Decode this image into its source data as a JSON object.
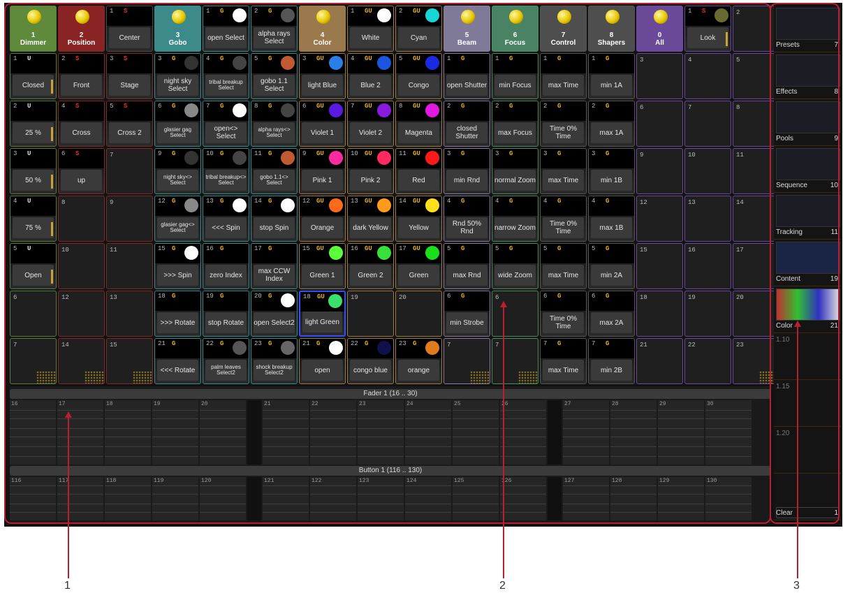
{
  "headers": [
    {
      "num": "1",
      "label": "Dimmer",
      "color": "#5f8a3c"
    },
    {
      "num": "2",
      "label": "Position",
      "color": "#8a2424"
    },
    {
      "num": "",
      "label": "",
      "color": ""
    },
    {
      "num": "3",
      "label": "Gobo",
      "color": "#3c8a8a"
    },
    {
      "num": "",
      "label": "",
      "color": ""
    },
    {
      "num": "",
      "label": "",
      "color": ""
    },
    {
      "num": "4",
      "label": "Color",
      "color": "#9a7a4c"
    },
    {
      "num": "",
      "label": "",
      "color": ""
    },
    {
      "num": "",
      "label": "",
      "color": ""
    },
    {
      "num": "5",
      "label": "Beam",
      "color": "#7f7a98"
    },
    {
      "num": "6",
      "label": "Focus",
      "color": "#4a8264"
    },
    {
      "num": "7",
      "label": "Control",
      "color": "#4e4e4e"
    },
    {
      "num": "8",
      "label": "Shapers",
      "color": "#4e4e4e"
    },
    {
      "num": "0",
      "label": "All",
      "color": "#6a4a98"
    }
  ],
  "grid": [
    [
      {
        "type": "header",
        "h": 0,
        "group": "Dimmer"
      },
      {
        "type": "header",
        "h": 1,
        "group": "Position"
      },
      {
        "num": "1",
        "tag": "S",
        "tagColor": "#e03030",
        "label": "Center",
        "group": "Center"
      },
      {
        "type": "header",
        "h": 3,
        "group": "Gobo"
      },
      {
        "num": "1",
        "tag": "G",
        "tagColor": "#e0b020",
        "swatch": "#ffffff",
        "label": "open Select",
        "group": "Gobo"
      },
      {
        "num": "2",
        "tag": "G",
        "tagColor": "#e0b020",
        "swatch": "#555555",
        "label": "alpha rays Select",
        "group": "Gobo"
      },
      {
        "type": "header",
        "h": 6,
        "group": "Color"
      },
      {
        "num": "1",
        "tag": "GU",
        "tagColor": "#e0b020",
        "swatch": "#ffffff",
        "label": "White",
        "group": "Color"
      },
      {
        "num": "2",
        "tag": "GU",
        "tagColor": "#e0b020",
        "swatch": "#19d6d6",
        "label": "Cyan",
        "group": "Color"
      },
      {
        "type": "header",
        "h": 9,
        "group": "Beam"
      },
      {
        "type": "header",
        "h": 10,
        "group": "Focus"
      },
      {
        "type": "header",
        "h": 11,
        "group": "Control"
      },
      {
        "type": "header",
        "h": 12,
        "group": "Shapers"
      },
      {
        "type": "header",
        "h": 13,
        "group": "All"
      },
      {
        "num": "1",
        "tag": "S",
        "tagColor": "#e03030",
        "swatch": "#6a6a30",
        "label": "Look",
        "group": "Look",
        "bar": true
      },
      {
        "type": "empty",
        "num": "2",
        "group": "Look"
      }
    ],
    [
      {
        "num": "1",
        "tag": "U",
        "tagColor": "#dddddd",
        "label": "Closed",
        "group": "Dimmer",
        "bar": true
      },
      {
        "num": "2",
        "tag": "S",
        "tagColor": "#e03030",
        "label": "Front",
        "group": "Position"
      },
      {
        "num": "3",
        "tag": "S",
        "tagColor": "#e03030",
        "label": "Stage",
        "group": "Position"
      },
      {
        "num": "3",
        "tag": "G",
        "tagColor": "#e0b020",
        "swatch": "#333333",
        "label": "night sky Select",
        "group": "Gobo"
      },
      {
        "num": "4",
        "tag": "G",
        "tagColor": "#e0b020",
        "swatch": "#444444",
        "label": "tribal breakup Select",
        "group": "Gobo",
        "small": true
      },
      {
        "num": "5",
        "tag": "G",
        "tagColor": "#e0b020",
        "swatch": "#c05a30",
        "label": "gobo 1.1 Select",
        "group": "Gobo"
      },
      {
        "num": "3",
        "tag": "GU",
        "tagColor": "#e0b020",
        "swatch": "#2a7ee8",
        "label": "light Blue",
        "group": "Color"
      },
      {
        "num": "4",
        "tag": "GU",
        "tagColor": "#e0b020",
        "swatch": "#1a56e0",
        "label": "Blue 2",
        "group": "Color"
      },
      {
        "num": "5",
        "tag": "GU",
        "tagColor": "#e0b020",
        "swatch": "#1a2ae0",
        "label": "Congo",
        "group": "Color"
      },
      {
        "num": "1",
        "tag": "G",
        "tagColor": "#e0b020",
        "label": "open Shutter",
        "group": "Beam"
      },
      {
        "num": "1",
        "tag": "G",
        "tagColor": "#e0b020",
        "label": "min Focus",
        "group": "Focus"
      },
      {
        "num": "1",
        "tag": "G",
        "tagColor": "#e0b020",
        "label": "max Time",
        "group": "Control"
      },
      {
        "num": "1",
        "tag": "G",
        "tagColor": "#e0b020",
        "label": "min 1A",
        "group": "Shapers"
      },
      {
        "type": "empty",
        "num": "3",
        "group": "All"
      },
      {
        "type": "empty",
        "num": "4",
        "group": "Look"
      },
      {
        "type": "empty",
        "num": "5",
        "group": "Look"
      }
    ],
    [
      {
        "num": "2",
        "tag": "U",
        "tagColor": "#dddddd",
        "label": "25 %",
        "group": "Dimmer",
        "bar": true
      },
      {
        "num": "4",
        "tag": "S",
        "tagColor": "#e03030",
        "label": "Cross",
        "group": "Position"
      },
      {
        "num": "5",
        "tag": "S",
        "tagColor": "#e03030",
        "label": "Cross 2",
        "group": "Position"
      },
      {
        "num": "6",
        "tag": "G",
        "tagColor": "#e0b020",
        "swatch": "#888888",
        "label": "glasier gag Select",
        "group": "Gobo",
        "small": true
      },
      {
        "num": "7",
        "tag": "G",
        "tagColor": "#e0b020",
        "swatch": "#ffffff",
        "label": "open<> Select",
        "group": "Gobo"
      },
      {
        "num": "8",
        "tag": "G",
        "tagColor": "#e0b020",
        "swatch": "#444444",
        "label": "alpha rays<> Select",
        "group": "Gobo",
        "small": true
      },
      {
        "num": "6",
        "tag": "GU",
        "tagColor": "#e0b020",
        "swatch": "#5a1ae0",
        "label": "Violet 1",
        "group": "Color"
      },
      {
        "num": "7",
        "tag": "GU",
        "tagColor": "#e0b020",
        "swatch": "#8a1ae0",
        "label": "Violet 2",
        "group": "Color"
      },
      {
        "num": "8",
        "tag": "GU",
        "tagColor": "#e0b020",
        "swatch": "#e01ae0",
        "label": "Magenta",
        "group": "Color"
      },
      {
        "num": "2",
        "tag": "G",
        "tagColor": "#e0b020",
        "label": "closed Shutter",
        "group": "Beam"
      },
      {
        "num": "2",
        "tag": "G",
        "tagColor": "#e0b020",
        "label": "max Focus",
        "group": "Focus"
      },
      {
        "num": "2",
        "tag": "G",
        "tagColor": "#e0b020",
        "label": "Time 0% Time",
        "group": "Control"
      },
      {
        "num": "2",
        "tag": "G",
        "tagColor": "#e0b020",
        "label": "max 1A",
        "group": "Shapers"
      },
      {
        "type": "empty",
        "num": "6",
        "group": "All"
      },
      {
        "type": "empty",
        "num": "7",
        "group": "Look"
      },
      {
        "type": "empty",
        "num": "8",
        "group": "Look"
      }
    ],
    [
      {
        "num": "3",
        "tag": "U",
        "tagColor": "#dddddd",
        "label": "50 %",
        "group": "Dimmer",
        "bar": true
      },
      {
        "num": "6",
        "tag": "S",
        "tagColor": "#e03030",
        "label": "up",
        "group": "Position"
      },
      {
        "type": "empty",
        "num": "7",
        "group": "Position"
      },
      {
        "num": "9",
        "tag": "G",
        "tagColor": "#e0b020",
        "swatch": "#333333",
        "label": "night sky<> Select",
        "group": "Gobo",
        "small": true
      },
      {
        "num": "10",
        "tag": "G",
        "tagColor": "#e0b020",
        "swatch": "#444444",
        "label": "tribal breakup<> Select",
        "group": "Gobo",
        "small": true
      },
      {
        "num": "11",
        "tag": "G",
        "tagColor": "#e0b020",
        "swatch": "#c05a30",
        "label": "gobo 1.1<> Select",
        "group": "Gobo",
        "small": true
      },
      {
        "num": "9",
        "tag": "GU",
        "tagColor": "#e0b020",
        "swatch": "#ff2aa0",
        "label": "Pink 1",
        "group": "Color"
      },
      {
        "num": "10",
        "tag": "GU",
        "tagColor": "#e0b020",
        "swatch": "#ff2a60",
        "label": "Pink 2",
        "group": "Color"
      },
      {
        "num": "11",
        "tag": "GU",
        "tagColor": "#e0b020",
        "swatch": "#ff1a1a",
        "label": "Red",
        "group": "Color"
      },
      {
        "num": "3",
        "tag": "G",
        "tagColor": "#e0b020",
        "label": "min Rnd",
        "group": "Beam"
      },
      {
        "num": "3",
        "tag": "G",
        "tagColor": "#e0b020",
        "label": "normal Zoom",
        "group": "Focus"
      },
      {
        "num": "3",
        "tag": "G",
        "tagColor": "#e0b020",
        "label": "max Time",
        "group": "Control"
      },
      {
        "num": "3",
        "tag": "G",
        "tagColor": "#e0b020",
        "label": "min 1B",
        "group": "Shapers"
      },
      {
        "type": "empty",
        "num": "9",
        "group": "All"
      },
      {
        "type": "empty",
        "num": "10",
        "group": "Look"
      },
      {
        "type": "empty",
        "num": "11",
        "group": "Look"
      }
    ],
    [
      {
        "num": "4",
        "tag": "U",
        "tagColor": "#dddddd",
        "label": "75 %",
        "group": "Dimmer",
        "bar": true
      },
      {
        "type": "empty",
        "num": "8",
        "group": "Position"
      },
      {
        "type": "empty",
        "num": "9",
        "group": "Position"
      },
      {
        "num": "12",
        "tag": "G",
        "tagColor": "#e0b020",
        "swatch": "#888888",
        "label": "glasier gag<> Select",
        "group": "Gobo",
        "small": true
      },
      {
        "num": "13",
        "tag": "G",
        "tagColor": "#e0b020",
        "swatch": "#ffffff",
        "label": "<<< Spin",
        "group": "Gobo"
      },
      {
        "num": "14",
        "tag": "G",
        "tagColor": "#e0b020",
        "swatch": "#ffffff",
        "label": "stop Spin",
        "group": "Gobo"
      },
      {
        "num": "12",
        "tag": "GU",
        "tagColor": "#e0b020",
        "swatch": "#ff6a1a",
        "label": "Orange",
        "group": "Color"
      },
      {
        "num": "13",
        "tag": "GU",
        "tagColor": "#e0b020",
        "swatch": "#ff9a1a",
        "label": "dark Yellow",
        "group": "Color"
      },
      {
        "num": "14",
        "tag": "GU",
        "tagColor": "#e0b020",
        "swatch": "#ffe01a",
        "label": "Yellow",
        "group": "Color"
      },
      {
        "num": "4",
        "tag": "G",
        "tagColor": "#e0b020",
        "label": "Rnd 50% Rnd",
        "group": "Beam"
      },
      {
        "num": "4",
        "tag": "G",
        "tagColor": "#e0b020",
        "label": "narrow Zoom",
        "group": "Focus"
      },
      {
        "num": "4",
        "tag": "G",
        "tagColor": "#e0b020",
        "label": "Time 0% Time",
        "group": "Control"
      },
      {
        "num": "4",
        "tag": "G",
        "tagColor": "#e0b020",
        "label": "max 1B",
        "group": "Shapers"
      },
      {
        "type": "empty",
        "num": "12",
        "group": "All"
      },
      {
        "type": "empty",
        "num": "13",
        "group": "Look"
      },
      {
        "type": "empty",
        "num": "14",
        "group": "Look"
      }
    ],
    [
      {
        "num": "5",
        "tag": "U",
        "tagColor": "#dddddd",
        "label": "Open",
        "group": "Dimmer",
        "bar": true
      },
      {
        "type": "empty",
        "num": "10",
        "group": "Position"
      },
      {
        "type": "empty",
        "num": "11",
        "group": "Position"
      },
      {
        "num": "15",
        "tag": "G",
        "tagColor": "#e0b020",
        "swatch": "#ffffff",
        "label": ">>> Spin",
        "group": "Gobo"
      },
      {
        "num": "16",
        "tag": "G",
        "tagColor": "#e0b020",
        "label": "zero Index",
        "group": "Gobo"
      },
      {
        "num": "17",
        "tag": "G",
        "tagColor": "#e0b020",
        "label": "max CCW Index",
        "group": "Gobo"
      },
      {
        "num": "15",
        "tag": "GU",
        "tagColor": "#e0b020",
        "swatch": "#5aff3a",
        "label": "Green 1",
        "group": "Color"
      },
      {
        "num": "16",
        "tag": "GU",
        "tagColor": "#e0b020",
        "swatch": "#3ae03a",
        "label": "Green 2",
        "group": "Color"
      },
      {
        "num": "17",
        "tag": "GU",
        "tagColor": "#e0b020",
        "swatch": "#1ae01a",
        "label": "Green",
        "group": "Color"
      },
      {
        "num": "5",
        "tag": "G",
        "tagColor": "#e0b020",
        "label": "max Rnd",
        "group": "Beam"
      },
      {
        "num": "5",
        "tag": "G",
        "tagColor": "#e0b020",
        "label": "wide Zoom",
        "group": "Focus"
      },
      {
        "num": "5",
        "tag": "G",
        "tagColor": "#e0b020",
        "label": "max Time",
        "group": "Control"
      },
      {
        "num": "5",
        "tag": "G",
        "tagColor": "#e0b020",
        "label": "min 2A",
        "group": "Shapers"
      },
      {
        "type": "empty",
        "num": "15",
        "group": "All"
      },
      {
        "type": "empty",
        "num": "16",
        "group": "Look"
      },
      {
        "type": "empty",
        "num": "17",
        "group": "Look"
      }
    ],
    [
      {
        "type": "empty",
        "num": "6",
        "group": "Dimmer"
      },
      {
        "type": "empty",
        "num": "12",
        "group": "Position"
      },
      {
        "type": "empty",
        "num": "13",
        "group": "Position"
      },
      {
        "num": "18",
        "tag": "G",
        "tagColor": "#e0b020",
        "label": ">>> Rotate",
        "group": "Gobo"
      },
      {
        "num": "19",
        "tag": "G",
        "tagColor": "#e0b020",
        "label": "stop Rotate",
        "group": "Gobo"
      },
      {
        "num": "20",
        "tag": "G",
        "tagColor": "#e0b020",
        "swatch": "#ffffff",
        "label": "open Select2",
        "group": "Gobo"
      },
      {
        "num": "18",
        "tag": "GU",
        "tagColor": "#e0b020",
        "swatch": "#3ae06a",
        "label": "light Green",
        "group": "Color",
        "selected": true
      },
      {
        "type": "empty",
        "num": "19",
        "group": "Color"
      },
      {
        "type": "empty",
        "num": "20",
        "group": "Color"
      },
      {
        "num": "6",
        "tag": "G",
        "tagColor": "#e0b020",
        "label": "min Strobe",
        "group": "Beam"
      },
      {
        "type": "empty",
        "num": "6",
        "group": "Focus"
      },
      {
        "num": "6",
        "tag": "G",
        "tagColor": "#e0b020",
        "label": "Time 0% Time",
        "group": "Control"
      },
      {
        "num": "6",
        "tag": "G",
        "tagColor": "#e0b020",
        "label": "max 2A",
        "group": "Shapers"
      },
      {
        "type": "empty",
        "num": "18",
        "group": "All"
      },
      {
        "type": "empty",
        "num": "19",
        "group": "Look"
      },
      {
        "type": "empty",
        "num": "20",
        "group": "Look"
      }
    ],
    [
      {
        "type": "empty",
        "num": "7",
        "group": "Dimmer",
        "dots": true
      },
      {
        "type": "empty",
        "num": "14",
        "group": "Position",
        "dots": true
      },
      {
        "type": "empty",
        "num": "15",
        "group": "Position",
        "dots": true
      },
      {
        "num": "21",
        "tag": "G",
        "tagColor": "#e0b020",
        "label": "<<< Rotate",
        "group": "Gobo"
      },
      {
        "num": "22",
        "tag": "G",
        "tagColor": "#e0b020",
        "swatch": "#555555",
        "label": "palm leaves Select2",
        "group": "Gobo",
        "small": true
      },
      {
        "num": "23",
        "tag": "G",
        "tagColor": "#e0b020",
        "swatch": "#666666",
        "label": "shock breakup Select2",
        "group": "Gobo",
        "small": true
      },
      {
        "num": "21",
        "tag": "G",
        "tagColor": "#e0b020",
        "swatch": "#ffffff",
        "label": "open",
        "group": "Color"
      },
      {
        "num": "22",
        "tag": "G",
        "tagColor": "#e0b020",
        "swatch": "#10104a",
        "label": "congo blue",
        "group": "Color"
      },
      {
        "num": "23",
        "tag": "G",
        "tagColor": "#e0b020",
        "swatch": "#e07a1a",
        "label": "orange",
        "group": "Color"
      },
      {
        "type": "empty",
        "num": "7",
        "group": "Beam",
        "dots": true
      },
      {
        "type": "empty",
        "num": "7",
        "group": "Focus",
        "dots": true
      },
      {
        "num": "7",
        "tag": "G",
        "tagColor": "#e0b020",
        "label": "max Time",
        "group": "Control"
      },
      {
        "num": "7",
        "tag": "G",
        "tagColor": "#e0b020",
        "label": "min 2B",
        "group": "Shapers"
      },
      {
        "type": "empty",
        "num": "21",
        "group": "All"
      },
      {
        "type": "empty",
        "num": "22",
        "group": "Look"
      },
      {
        "type": "empty",
        "num": "23",
        "group": "Look",
        "dots": true
      }
    ]
  ],
  "fader": {
    "title": "Fader  1 (16 .. 30)",
    "numbers": [
      "16",
      "17",
      "18",
      "19",
      "20",
      "21",
      "22",
      "23",
      "24",
      "25",
      "26",
      "27",
      "28",
      "29",
      "30"
    ]
  },
  "button": {
    "title": "Button  1 (116 .. 130)",
    "numbers": [
      "116",
      "117",
      "118",
      "119",
      "120",
      "121",
      "122",
      "123",
      "124",
      "125",
      "126",
      "127",
      "128",
      "129",
      "130"
    ]
  },
  "sidebar": [
    {
      "label": "Presets",
      "value": "7"
    },
    {
      "label": "Effects",
      "value": "8"
    },
    {
      "label": "Pools",
      "value": "9"
    },
    {
      "label": "Sequence",
      "value": "10"
    },
    {
      "label": "Tracking",
      "value": "11"
    },
    {
      "label": "Content",
      "value": "19"
    },
    {
      "label": "Color",
      "value": "21"
    },
    {
      "label": "1.10",
      "value": ""
    },
    {
      "label": "1.15",
      "value": ""
    },
    {
      "label": "1.20",
      "value": ""
    },
    {
      "label": "Clear",
      "value": "1"
    }
  ],
  "callouts": [
    "1",
    "2",
    "3"
  ]
}
